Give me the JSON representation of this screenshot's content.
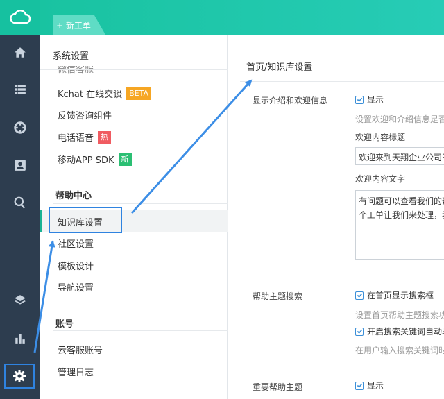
{
  "topbar": {
    "new_ticket_label": "+ 新工单"
  },
  "rail": {
    "items": [
      {
        "icon": "home-icon"
      },
      {
        "icon": "list-icon"
      },
      {
        "icon": "lifebuoy-icon"
      },
      {
        "icon": "contact-card-icon"
      },
      {
        "icon": "search-icon"
      },
      {
        "icon": "layers-icon"
      },
      {
        "icon": "bar-chart-icon"
      },
      {
        "icon": "gear-icon"
      }
    ]
  },
  "menu": {
    "title": "系统设置",
    "clipped_item": "微信客服",
    "items_top": [
      {
        "label": "Kchat 在线交谈",
        "badge": "BETA"
      },
      {
        "label": "反馈咨询组件",
        "badge": ""
      },
      {
        "label": "电话语音",
        "badge": "热"
      },
      {
        "label": "移动APP SDK",
        "badge": "新"
      }
    ],
    "help_center": {
      "heading": "帮助中心",
      "items": [
        "知识库设置",
        "社区设置",
        "模板设计",
        "导航设置"
      ]
    },
    "account": {
      "heading": "账号",
      "items": [
        "云客服账号",
        "管理日志"
      ]
    }
  },
  "content": {
    "page_title": "首页/知识库设置",
    "intro_section": {
      "label": "显示介绍和欢迎信息",
      "checkbox_label": "显示",
      "hint": "设置欢迎和介绍信息是否",
      "title_field_label": "欢迎内容标题",
      "title_field_value": "欢迎来到天翔企业公司的",
      "text_field_label": "欢迎内容文字",
      "text_field_lines": [
        "有问题可以查看我们的帮",
        "个工单让我们来处理，我"
      ]
    },
    "search_section": {
      "label": "帮助主题搜索",
      "checkbox1_label": "在首页显示搜索框",
      "hint1": "设置首页帮助主题搜索功",
      "checkbox2_label": "开启搜索关键词自动联",
      "hint2": "在用户输入搜索关键词时"
    },
    "important_section": {
      "label": "重要帮助主题",
      "checkbox_label": "显示"
    }
  },
  "colors": {
    "rail_bg": "#2d3d4f",
    "accent_teal": "#19c3a1",
    "annotation_blue": "#2f83e0"
  }
}
